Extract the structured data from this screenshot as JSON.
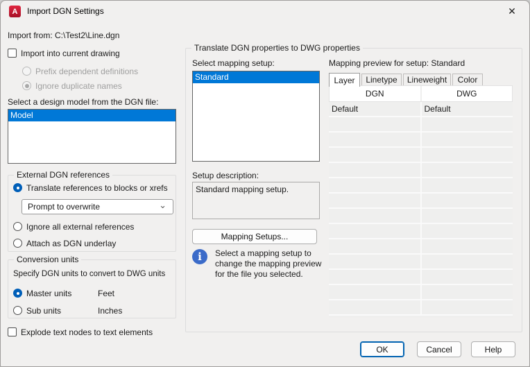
{
  "window": {
    "title": "Import DGN Settings",
    "close_glyph": "✕",
    "app_glyph": "A"
  },
  "header": {
    "import_from": "Import from: C:\\Test2\\Line.dgn"
  },
  "left": {
    "import_checkbox": "Import into current drawing",
    "radio_prefix": "Prefix dependent definitions",
    "radio_ignore_dup": "Ignore duplicate names",
    "model_label": "Select a design model from the DGN file:",
    "model_list": [
      "Model"
    ],
    "external_group": {
      "title": "External DGN references",
      "radio_translate": "Translate references to blocks or xrefs",
      "dropdown_value": "Prompt to overwrite",
      "dropdown_chevron": "⌄",
      "radio_ignore": "Ignore all external references",
      "radio_attach": "Attach as DGN underlay"
    },
    "conversion_group": {
      "title": "Conversion units",
      "subtitle": "Specify DGN units to convert to DWG units",
      "radio_master": "Master units",
      "master_value": "Feet",
      "radio_sub": "Sub units",
      "sub_value": "Inches"
    },
    "explode_checkbox": "Explode text nodes to text elements"
  },
  "right": {
    "group_title": "Translate DGN properties to DWG properties",
    "mapping_setup_label": "Select mapping setup:",
    "mapping_setups": [
      "Standard"
    ],
    "setup_description_label": "Setup description:",
    "setup_description": "Standard mapping setup.",
    "mapping_setups_button": "Mapping Setups...",
    "info_glyph": "i",
    "info_text": "Select a mapping setup to change the mapping preview for the file you selected.",
    "preview_label": "Mapping preview for setup: Standard",
    "tabs": [
      "Layer",
      "Linetype",
      "Lineweight",
      "Color"
    ],
    "active_tab": "Layer",
    "table": {
      "columns": [
        "DGN",
        "DWG"
      ],
      "rows": [
        [
          "Default",
          "Default"
        ]
      ],
      "empty_row_count": 13
    }
  },
  "footer": {
    "ok": "OK",
    "cancel": "Cancel",
    "help": "Help"
  },
  "colors": {
    "selection": "#0078d7",
    "accent": "#005fb8",
    "info_icon": "#3b6bc9",
    "focus_border": "#0062b1"
  }
}
